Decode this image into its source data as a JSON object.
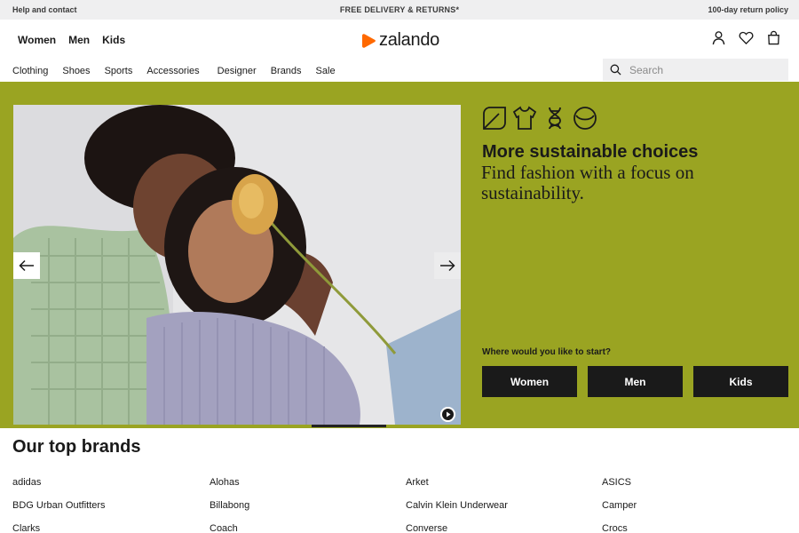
{
  "topbar": {
    "help": "Help and contact",
    "delivery": "FREE DELIVERY & RETURNS*",
    "returns": "100-day return policy"
  },
  "header": {
    "gender_tabs": [
      "Women",
      "Men",
      "Kids"
    ],
    "logo_text": "zalando",
    "logo_color": "#ff6900",
    "icons": [
      "account-icon",
      "wishlist-heart-icon",
      "bag-icon"
    ]
  },
  "categories": [
    "Clothing",
    "Shoes",
    "Sports",
    "Accessories",
    "Designer",
    "Brands",
    "Sale"
  ],
  "search": {
    "placeholder": "Search"
  },
  "hero": {
    "background": "#9aa422",
    "title": "More sustainable choices",
    "subtitle": "Find fashion with a focus on sustainability.",
    "start_question": "Where would you like to start?",
    "cta": [
      "Women",
      "Men",
      "Kids"
    ],
    "eco_icons": [
      "leaf-icon",
      "tshirt-icon",
      "dna-icon",
      "smile-icon"
    ]
  },
  "brands": {
    "title": "Our top brands",
    "columns": [
      [
        "adidas",
        "BDG Urban Outfitters",
        "Clarks"
      ],
      [
        "Alohas",
        "Billabong",
        "Coach"
      ],
      [
        "Arket",
        "Calvin Klein Underwear",
        "Converse"
      ],
      [
        "ASICS",
        "Camper",
        "Crocs"
      ]
    ]
  }
}
